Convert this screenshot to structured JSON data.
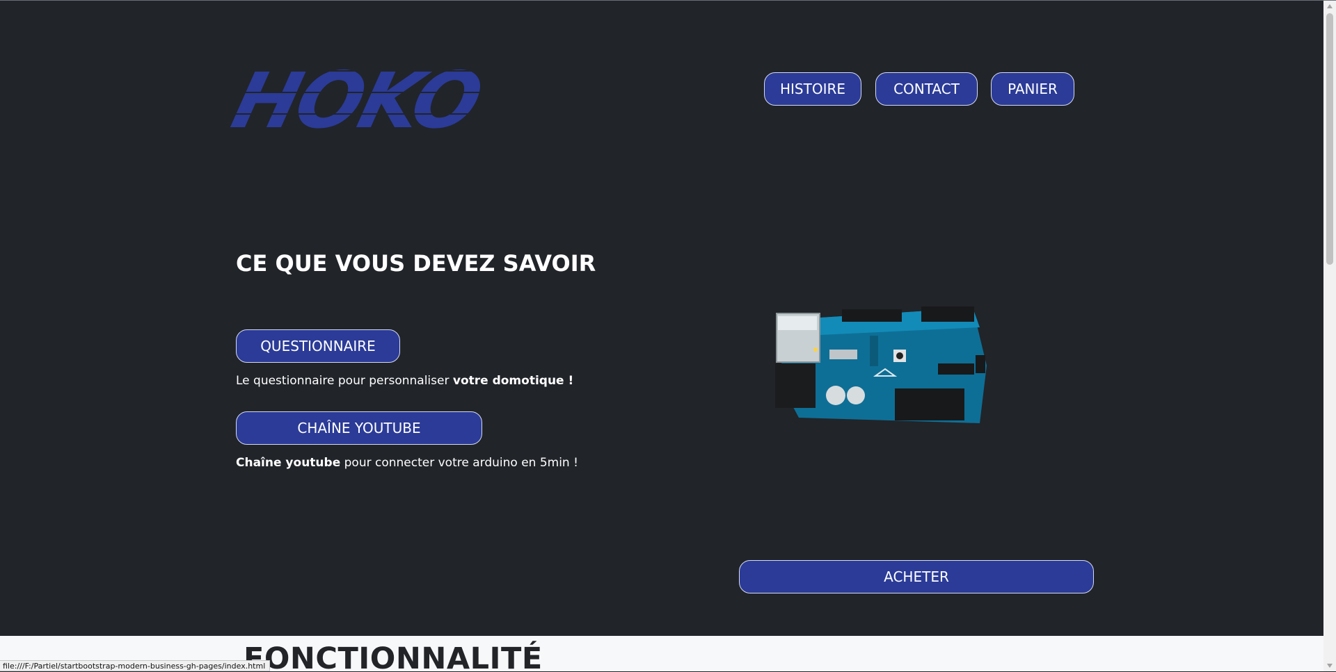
{
  "brand": {
    "logo_text": "HOKO",
    "color": "#2b3b97"
  },
  "nav": {
    "items": [
      {
        "label": "HISTOIRE"
      },
      {
        "label": "CONTACT"
      },
      {
        "label": "PANIER"
      }
    ]
  },
  "main": {
    "title": "CE QUE VOUS DEVEZ SAVOIR",
    "questionnaire": {
      "button_label": "QUESTIONNAIRE",
      "desc_prefix": "Le questionnaire pour personnaliser ",
      "desc_bold": "votre domotique !"
    },
    "youtube": {
      "button_label": "CHAÎNE YOUTUBE",
      "desc_bold": "Chaîne youtube",
      "desc_suffix": " pour connecter votre arduino en 5min !"
    },
    "product": {
      "image_icon": "arduino-board-image",
      "buy_label": "ACHETER"
    }
  },
  "lower_section": {
    "title": "FONCTIONNALITÉ"
  },
  "status_bar": {
    "url": "file:///F:/Partiel/startbootstrap-modern-business-gh-pages/index.html"
  },
  "colors": {
    "background": "#212429",
    "button": "#2b3b97",
    "button_border": "#d8dcf0",
    "light_section": "#f7f8fa"
  }
}
